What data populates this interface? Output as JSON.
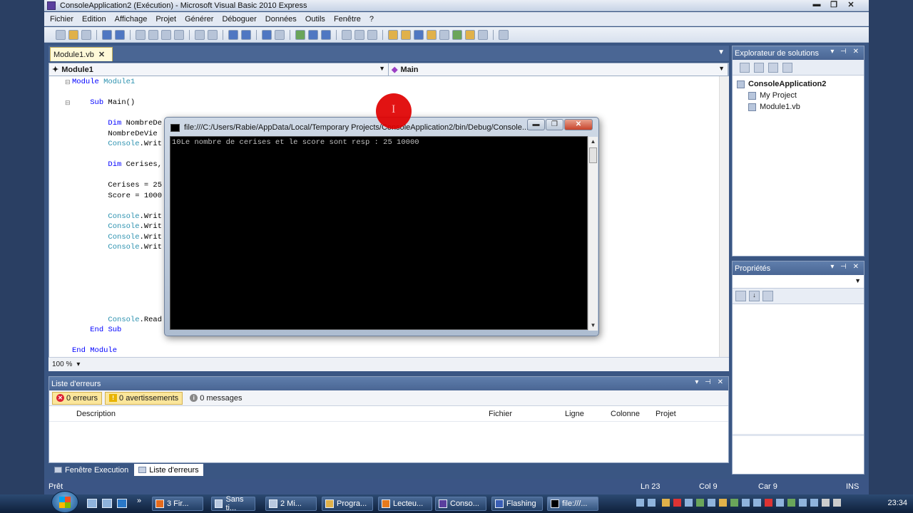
{
  "window": {
    "title": "ConsoleApplication2 (Exécution) - Microsoft Visual Basic 2010 Express",
    "controls": [
      "▬",
      "❐",
      "✕"
    ]
  },
  "menu": [
    "Fichier",
    "Edition",
    "Affichage",
    "Projet",
    "Générer",
    "Déboguer",
    "Données",
    "Outils",
    "Fenêtre",
    "?"
  ],
  "editor": {
    "tab_label": "Module1.vb",
    "tab_close": "✕",
    "nav_left": "Module1",
    "nav_right": "Main",
    "zoom": "100 %",
    "code": [
      {
        "t": "Module ",
        "k": "Module1",
        "y": 0
      },
      {
        "t": "    Sub Main()",
        "y": 2
      },
      {
        "t": "        Dim NombreDe",
        "y": 4
      },
      {
        "t": "        NombreDeVie",
        "y": 5
      },
      {
        "t": "        Console.Writ",
        "y": 6
      },
      {
        "t": "        Dim Cerises,",
        "y": 8
      },
      {
        "t": "        Cerises = 25",
        "y": 10
      },
      {
        "t": "        Score = 1000",
        "y": 11
      },
      {
        "t": "        Console.Writ",
        "y": 13
      },
      {
        "t": "        Console.Writ",
        "y": 14
      },
      {
        "t": "        Console.Writ",
        "y": 15
      },
      {
        "t": "        Console.Writ",
        "y": 16
      },
      {
        "t": "        Console.Read",
        "y": 23
      },
      {
        "t": "    End Sub",
        "y": 24
      },
      {
        "t": "End Module",
        "y": 26
      }
    ]
  },
  "console": {
    "title": "file:///C:/Users/Rabie/AppData/Local/Temporary Projects/ConsoleApplication2/bin/Debug/Console...",
    "output": "10Le nombre de cerises et le score sont resp : 25 10000",
    "controls": [
      "▬",
      "❐",
      "✕"
    ]
  },
  "solution_explorer": {
    "title": "Explorateur de solutions",
    "controls": "▾ ⊣ ✕",
    "items": [
      {
        "label": "ConsoleApplication2",
        "bold": true
      },
      {
        "label": "My Project",
        "bold": false
      },
      {
        "label": "Module1.vb",
        "bold": false
      }
    ]
  },
  "properties": {
    "title": "Propriétés",
    "controls": "▾ ⊣ ✕"
  },
  "error_list": {
    "title": "Liste d'erreurs",
    "controls": "▾ ⊣ ✕",
    "filters": {
      "errors": "0 erreurs",
      "warnings": "0 avertissements",
      "messages": "0 messages"
    },
    "columns": [
      "Description",
      "Fichier",
      "Ligne",
      "Colonne",
      "Projet"
    ]
  },
  "bottom_tabs": [
    "Fenêtre Execution",
    "Liste d'erreurs"
  ],
  "status": {
    "ready": "Prêt",
    "line": "Ln 23",
    "col": "Col 9",
    "car": "Car 9",
    "ins": "INS"
  },
  "taskbar": {
    "buttons": [
      "3 Fir...",
      "Sans ti...",
      "2 Mi...",
      "Progra...",
      "Lecteu...",
      "Conso...",
      "Flashing",
      "file:///..."
    ],
    "clock": "23:34"
  }
}
